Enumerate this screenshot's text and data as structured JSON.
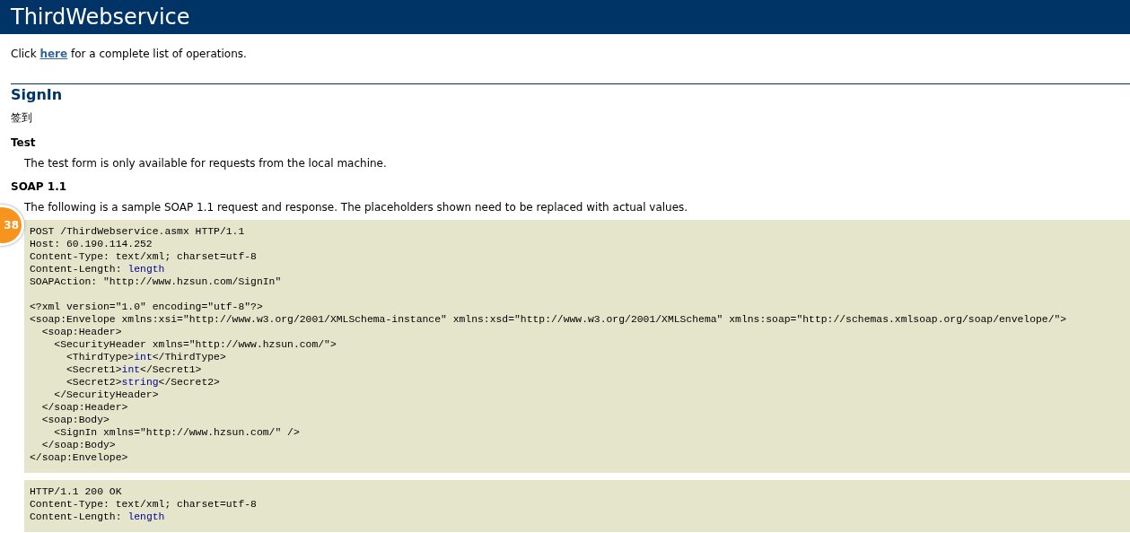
{
  "banner": {
    "title": "ThirdWebservice"
  },
  "intro": {
    "before": "Click ",
    "link": "here",
    "after": " for a complete list of operations."
  },
  "operation": {
    "name": "SignIn",
    "description": "签到"
  },
  "sections": [
    {
      "heading": "Test",
      "text": "The test form is only available for requests from the local machine."
    },
    {
      "heading": "SOAP 1.1",
      "text": "The following is a sample SOAP 1.1 request and response. The placeholders shown need to be replaced with actual values."
    }
  ],
  "badge": {
    "text": "38"
  },
  "request": {
    "sections": [
      {
        "lines": [
          [
            {
              "text": "POST /ThirdWebservice.asmx HTTP/1.1",
              "placeholder": false
            }
          ],
          [
            {
              "text": "Host: 60.190.114.252",
              "placeholder": false
            }
          ],
          [
            {
              "text": "Content-Type: text/xml; charset=utf-8",
              "placeholder": false
            }
          ],
          [
            {
              "text": "Content-Length: ",
              "placeholder": false
            },
            {
              "text": "length",
              "placeholder": true
            }
          ],
          [
            {
              "text": "SOAPAction: \"http://www.hzsun.com/SignIn\"",
              "placeholder": false
            }
          ]
        ]
      },
      {
        "lines": [
          [
            {
              "text": "<?xml version=\"1.0\" encoding=\"utf-8\"?>",
              "placeholder": false
            }
          ],
          [
            {
              "text": "<soap:Envelope xmlns:xsi=\"http://www.w3.org/2001/XMLSchema-instance\" xmlns:xsd=\"http://www.w3.org/2001/XMLSchema\" xmlns:soap=\"http://schemas.xmlsoap.org/soap/envelope/\">",
              "placeholder": false
            }
          ],
          [
            {
              "text": "  <soap:Header>",
              "placeholder": false
            }
          ],
          [
            {
              "text": "    <SecurityHeader xmlns=\"http://www.hzsun.com/\">",
              "placeholder": false
            }
          ],
          [
            {
              "text": "      <ThirdType>",
              "placeholder": false
            },
            {
              "text": "int",
              "placeholder": true
            },
            {
              "text": "</ThirdType>",
              "placeholder": false
            }
          ],
          [
            {
              "text": "      <Secret1>",
              "placeholder": false
            },
            {
              "text": "int",
              "placeholder": true
            },
            {
              "text": "</Secret1>",
              "placeholder": false
            }
          ],
          [
            {
              "text": "      <Secret2>",
              "placeholder": false
            },
            {
              "text": "string",
              "placeholder": true
            },
            {
              "text": "</Secret2>",
              "placeholder": false
            }
          ],
          [
            {
              "text": "    </SecurityHeader>",
              "placeholder": false
            }
          ],
          [
            {
              "text": "  </soap:Header>",
              "placeholder": false
            }
          ],
          [
            {
              "text": "  <soap:Body>",
              "placeholder": false
            }
          ],
          [
            {
              "text": "    <SignIn xmlns=\"http://www.hzsun.com/\" />",
              "placeholder": false
            }
          ],
          [
            {
              "text": "  </soap:Body>",
              "placeholder": false
            }
          ],
          [
            {
              "text": "</soap:Envelope>",
              "placeholder": false
            }
          ]
        ]
      }
    ]
  },
  "response": {
    "sections": [
      {
        "lines": [
          [
            {
              "text": "HTTP/1.1 200 OK",
              "placeholder": false
            }
          ],
          [
            {
              "text": "Content-Type: text/xml; charset=utf-8",
              "placeholder": false
            }
          ],
          [
            {
              "text": "Content-Length: ",
              "placeholder": false
            },
            {
              "text": "length",
              "placeholder": true
            }
          ]
        ]
      }
    ]
  }
}
